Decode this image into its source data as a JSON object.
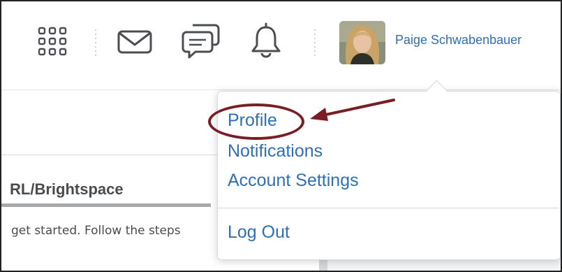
{
  "header": {
    "user_name": "Paige Schwabenbauer",
    "icons": [
      "grid-icon",
      "mail-icon",
      "chat-icon",
      "bell-icon"
    ]
  },
  "widget": {
    "title": "RL/Brightspace",
    "body": "get started. Follow the steps"
  },
  "dropdown": {
    "items": [
      {
        "label": "Profile"
      },
      {
        "label": "Notifications"
      },
      {
        "label": "Account Settings"
      }
    ],
    "logout_label": "Log Out"
  },
  "colors": {
    "link": "#2f6fb3",
    "annotation": "#7a1e25",
    "icon": "#4a4d52"
  }
}
